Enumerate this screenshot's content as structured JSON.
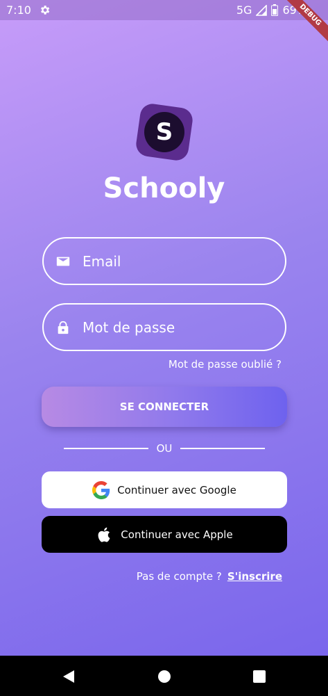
{
  "status_bar": {
    "time": "7:10",
    "network": "5G",
    "battery": "69%",
    "debug_label": "DEBUG"
  },
  "app": {
    "logo_letter": "S",
    "title": "Schooly"
  },
  "form": {
    "email_placeholder": "Email",
    "password_placeholder": "Mot de passe",
    "forgot_password": "Mot de passe oublié ?",
    "login_button": "SE CONNECTER",
    "divider_text": "OU"
  },
  "social": {
    "google_label": "Continuer avec Google",
    "apple_label": "Continuer avec Apple"
  },
  "signup": {
    "prompt": "Pas de compte ?",
    "link": "S'inscrire"
  },
  "colors": {
    "gradient_top": "#c79cf9",
    "gradient_bottom": "#7a66ec",
    "logo_bg": "#5b2c8e",
    "button_end": "#6e62ee"
  },
  "icons": {
    "settings": "gear-icon",
    "email": "mail-icon",
    "password": "lock-icon",
    "google": "google-icon",
    "apple": "apple-icon"
  }
}
